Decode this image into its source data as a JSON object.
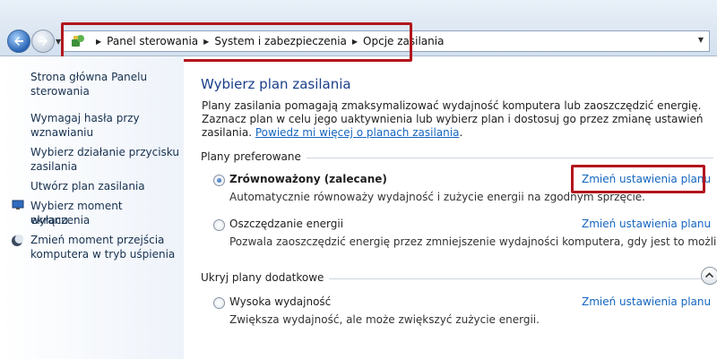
{
  "breadcrumb": [
    "Panel sterowania",
    "System i zabezpieczenia",
    "Opcje zasilania"
  ],
  "icons": {
    "back": "arrow-left-icon",
    "forward": "arrow-right-icon",
    "control_panel": "control-panel-icon",
    "monitor": "monitor-icon",
    "moon": "moon-icon",
    "collapse": "chevron-up-icon"
  },
  "sidebar": {
    "items": [
      "Strona główna Panelu",
      "sterowania",
      "Wymagaj hasła przy",
      "wznawianiu",
      "Wybierz działanie przycisku",
      "zasilania",
      "Utwórz plan zasilania",
      "Wybierz moment wyłączenia",
      "ekranu",
      "Zmień moment przejścia",
      "komputera w tryb uśpienia"
    ]
  },
  "main": {
    "title": "Wybierz plan zasilania",
    "intro_text": "Plany zasilania pomagają zmaksymalizować wydajność komputera lub zaoszczędzić energię. Zaznacz plan w celu jego uaktywnienia lub wybierz plan i dostosuj go przez zmianę ustawień zasilania. ",
    "intro_link": "Powiedz mi więcej o planach zasilania",
    "intro_end": ".",
    "preferred_label": "Plany preferowane",
    "hidden_label": "Ukryj plany dodatkowe",
    "plans": [
      {
        "name": "Zrównoważony (zalecane)",
        "desc": "Automatycznie równoważy wydajność i zużycie energii na zgodnym sprzęcie.",
        "change": "Zmień ustawienia planu",
        "selected": true
      },
      {
        "name": "Oszczędzanie energii",
        "desc": "Pozwala zaoszczędzić energię przez zmniejszenie wydajności komputera, gdy jest to możliwe.",
        "change": "Zmień ustawienia planu",
        "selected": false
      },
      {
        "name": "Wysoka wydajność",
        "desc": "Zwiększa wydajność, ale może zwiększyć zużycie energii.",
        "change": "Zmień ustawienia planu",
        "selected": false
      }
    ]
  },
  "colors": {
    "highlight": "#b3151c",
    "link": "#1566c0",
    "title": "#1a3e8a"
  }
}
